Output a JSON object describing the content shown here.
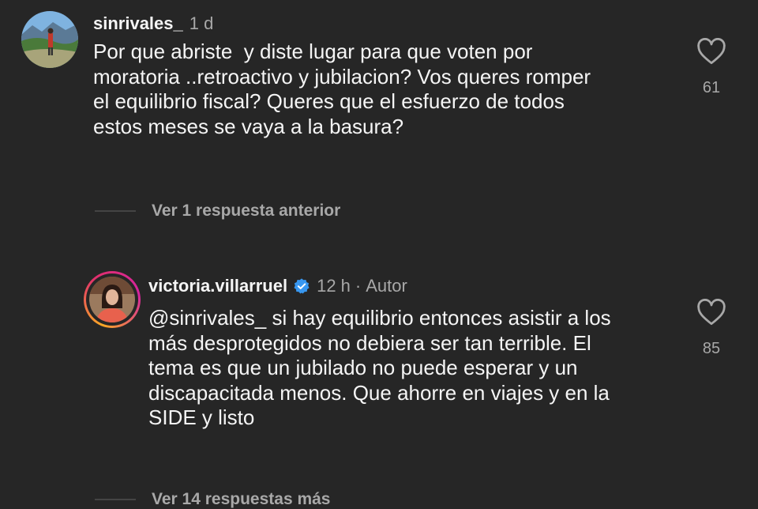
{
  "comments": [
    {
      "username": "sinrivales_",
      "time": "1 d",
      "text": "Por que abriste  y diste lugar para que voten por\nmoratoria ..retroactivo y jubilacion? Vos queres romper\nel equilibrio fiscal? Queres que el esfuerzo de todos\nestos meses se vaya a la basura?",
      "likes": "61"
    },
    {
      "username": "victoria.villarruel",
      "time": "12 h",
      "separator": "·",
      "author_label": "Autor",
      "text": "@sinrivales_ si hay equilibrio entonces asistir a los\nmás desprotegidos no debiera ser tan terrible. El\ntema es que un jubilado no puede esperar y un\ndiscapacitada menos. Que ahorre en viajes y en la\nSIDE y listo",
      "likes": "85"
    }
  ],
  "view_previous_replies": "Ver 1 respuesta anterior",
  "view_more_replies": "Ver 14 respuestas más",
  "icons": {
    "like": "heart-outline-icon",
    "verified": "verified-badge-icon"
  },
  "colors": {
    "background": "#262626",
    "text": "#f5f5f5",
    "muted": "#a8a8a8",
    "verified": "#3897f0",
    "story_ring_start": "#f9a825",
    "story_ring_end": "#d6249f"
  }
}
